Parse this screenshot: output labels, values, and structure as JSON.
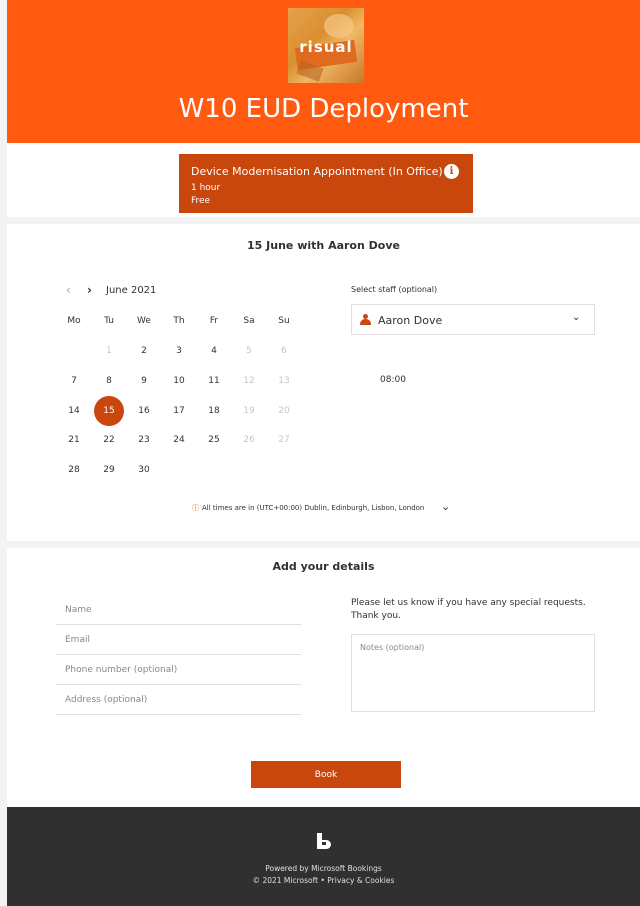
{
  "header": {
    "logo_text": "risual",
    "title": "W10 EUD Deployment"
  },
  "service": {
    "name": "Device Modernisation Appointment (In Office)",
    "duration": "1 hour",
    "price": "Free",
    "info_icon": "i"
  },
  "calendar": {
    "heading": "15 June with Aaron Dove",
    "prev_icon": "‹",
    "next_icon": "›",
    "month": "June 2021",
    "weekdays": [
      "Mo",
      "Tu",
      "We",
      "Th",
      "Fr",
      "Sa",
      "Su"
    ],
    "weeks": [
      [
        "",
        "1",
        "2",
        "3",
        "4",
        "5",
        "6"
      ],
      [
        "7",
        "8",
        "9",
        "10",
        "11",
        "12",
        "13"
      ],
      [
        "14",
        "15",
        "16",
        "17",
        "18",
        "19",
        "20"
      ],
      [
        "21",
        "22",
        "23",
        "24",
        "25",
        "26",
        "27"
      ],
      [
        "28",
        "29",
        "30",
        "",
        "",
        "",
        ""
      ]
    ],
    "selected_day": "15",
    "timezone_icon": "ⓘ",
    "timezone": "All times are in  (UTC+00:00) Dublin, Edinburgh, Lisbon, London",
    "timezone_chevron": "⌄"
  },
  "staff": {
    "label": "Select staff (optional)",
    "selected": "Aaron Dove",
    "chevron": "⌄",
    "time_slot": "08:00"
  },
  "details": {
    "heading": "Add your details",
    "name_placeholder": "Name",
    "email_placeholder": "Email",
    "phone_placeholder": "Phone number (optional)",
    "address_placeholder": "Address (optional)",
    "requests_text": "Please let us know if you have any special requests. Thank you.",
    "notes_placeholder": "Notes (optional)",
    "book_label": "Book"
  },
  "footer": {
    "powered_by": "Powered by Microsoft Bookings",
    "copyright": "© 2021 Microsoft",
    "separator": "•",
    "privacy": "Privacy & Cookies"
  },
  "colors": {
    "header": "#ff5a0f",
    "accent": "#c9460c",
    "footer": "#303030"
  }
}
